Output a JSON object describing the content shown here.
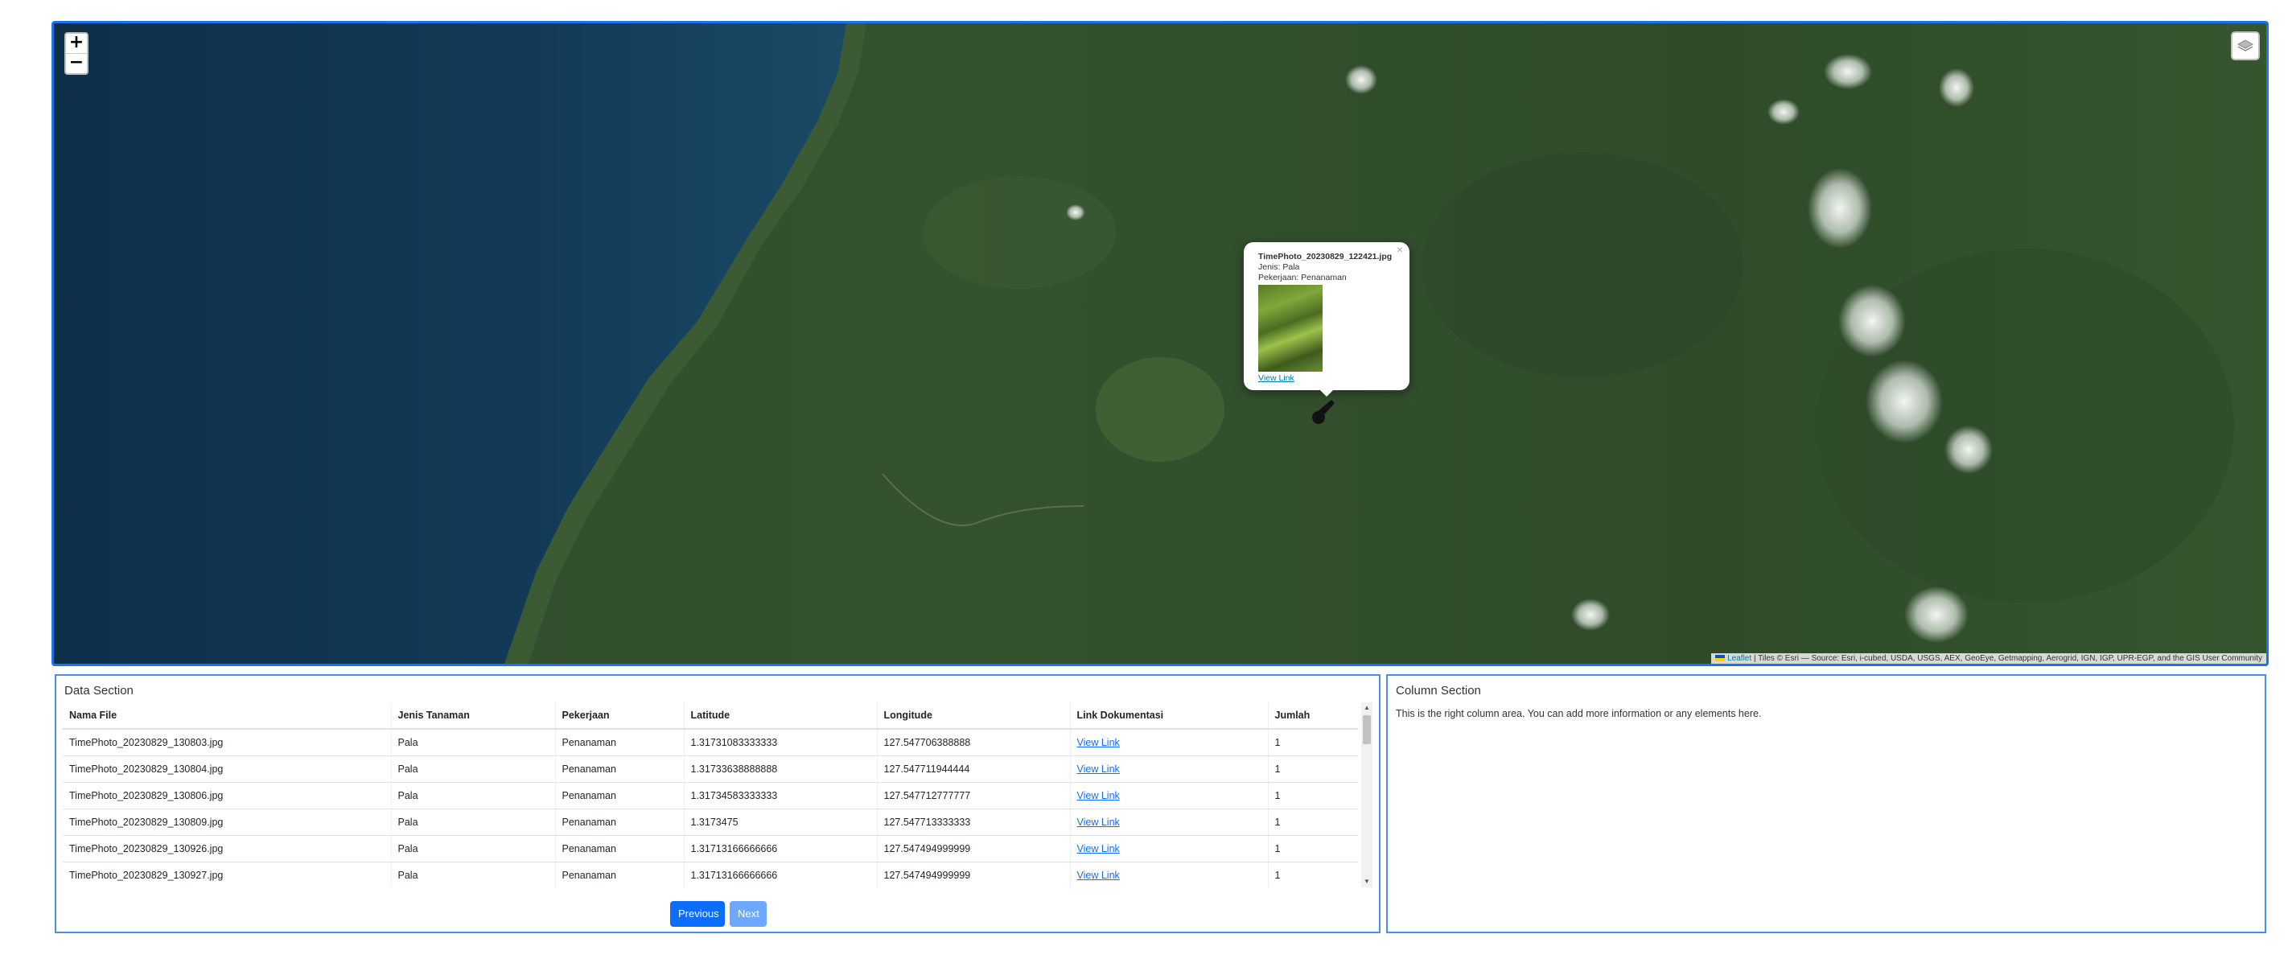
{
  "map": {
    "zoom_in": "+",
    "zoom_out": "−",
    "layers_icon": "layers-icon",
    "attribution": {
      "leaflet": "Leaflet",
      "tiles": "| Tiles © Esri — Source: Esri, i-cubed, USDA, USGS, AEX, GeoEye, Getmapping, Aerogrid, IGN, IGP, UPR-EGP, and the GIS User Community"
    },
    "popup": {
      "filename": "TimePhoto_20230829_122421.jpg",
      "jenis": "Jenis: Pala",
      "pekerjaan": "Pekerjaan: Penanaman",
      "link": "View Link",
      "close": "×"
    }
  },
  "data_section": {
    "title": "Data Section",
    "columns": [
      "Nama File",
      "Jenis Tanaman",
      "Pekerjaan",
      "Latitude",
      "Longitude",
      "Link Dokumentasi",
      "Jumlah"
    ],
    "rows": [
      [
        "TimePhoto_20230829_130803.jpg",
        "Pala",
        "Penanaman",
        "1.31731083333333",
        "127.547706388888",
        "View Link",
        "1"
      ],
      [
        "TimePhoto_20230829_130804.jpg",
        "Pala",
        "Penanaman",
        "1.31733638888888",
        "127.547711944444",
        "View Link",
        "1"
      ],
      [
        "TimePhoto_20230829_130806.jpg",
        "Pala",
        "Penanaman",
        "1.31734583333333",
        "127.547712777777",
        "View Link",
        "1"
      ],
      [
        "TimePhoto_20230829_130809.jpg",
        "Pala",
        "Penanaman",
        "1.3173475",
        "127.547713333333",
        "View Link",
        "1"
      ],
      [
        "TimePhoto_20230829_130926.jpg",
        "Pala",
        "Penanaman",
        "1.31713166666666",
        "127.547494999999",
        "View Link",
        "1"
      ],
      [
        "TimePhoto_20230829_130927.jpg",
        "Pala",
        "Penanaman",
        "1.31713166666666",
        "127.547494999999",
        "View Link",
        "1"
      ]
    ],
    "prev_label": "Previous",
    "next_label": "Next"
  },
  "column_section": {
    "title": "Column Section",
    "text": "This is the right column area. You can add more information or any elements here."
  }
}
